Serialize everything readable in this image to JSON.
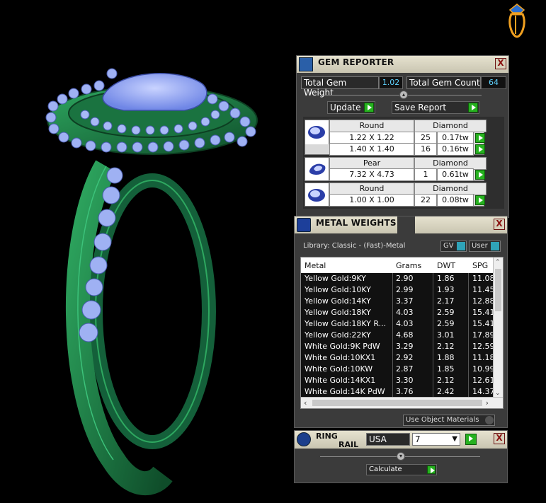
{
  "gem_reporter": {
    "title": "GEM REPORTER",
    "total_weight_label": "Total Gem Weight",
    "total_weight_value": "1.02",
    "total_count_label": "Total Gem Count",
    "total_count_value": "64",
    "update_label": "Update",
    "save_report_label": "Save Report",
    "close_label": "X",
    "groups": [
      {
        "shape": "Round",
        "material": "Diamond",
        "rows": [
          {
            "size": "1.22 X 1.22",
            "count": "25",
            "weight": "0.17tw"
          },
          {
            "size": "1.40 X 1.40",
            "count": "16",
            "weight": "0.16tw"
          }
        ]
      },
      {
        "shape": "Pear",
        "material": "Diamond",
        "rows": [
          {
            "size": "7.32 X 4.73",
            "count": "1",
            "weight": "0.61tw"
          }
        ]
      },
      {
        "shape": "Round",
        "material": "Diamond",
        "rows": [
          {
            "size": "1.00 X 1.00",
            "count": "22",
            "weight": "0.08tw"
          }
        ]
      }
    ]
  },
  "metal_weights": {
    "title": "METAL WEIGHTS",
    "library_label": "Library: Classic - (Fast)-Metal",
    "gv_label": "GV",
    "user_label": "User",
    "columns": [
      "Metal",
      "Grams",
      "DWT",
      "SPG"
    ],
    "rows": [
      [
        "Yellow Gold:9KY",
        "2.90",
        "1.86",
        "11.08"
      ],
      [
        "Yellow Gold:10KY",
        "2.99",
        "1.93",
        "11.45"
      ],
      [
        "Yellow Gold:14KY",
        "3.37",
        "2.17",
        "12.88"
      ],
      [
        "Yellow Gold:18KY",
        "4.03",
        "2.59",
        "15.41"
      ],
      [
        "Yellow Gold:18KY R...",
        "4.03",
        "2.59",
        "15.41"
      ],
      [
        "Yellow Gold:22KY",
        "4.68",
        "3.01",
        "17.89"
      ],
      [
        "White Gold:9K PdW",
        "3.29",
        "2.12",
        "12.59"
      ],
      [
        "White Gold:10KX1",
        "2.92",
        "1.88",
        "11.18"
      ],
      [
        "White Gold:10KW",
        "2.87",
        "1.85",
        "10.99"
      ],
      [
        "White Gold:14KX1",
        "3.30",
        "2.12",
        "12.61"
      ],
      [
        "White Gold:14K PdW",
        "3.76",
        "2.42",
        "14.37"
      ]
    ],
    "use_object_materials_label": "Use Object Materials",
    "close_label": "X"
  },
  "ring_rail": {
    "title_line1": "RING",
    "title_line2": "RAIL",
    "region_value": "USA",
    "size_value": "7",
    "calculate_label": "Calculate",
    "close_label": "X"
  },
  "colors": {
    "metal_green": "#1f8a4c",
    "gem_blue": "#8fa6f0",
    "number_cyan": "#5fd3ff",
    "button_green": "#26b11f"
  }
}
